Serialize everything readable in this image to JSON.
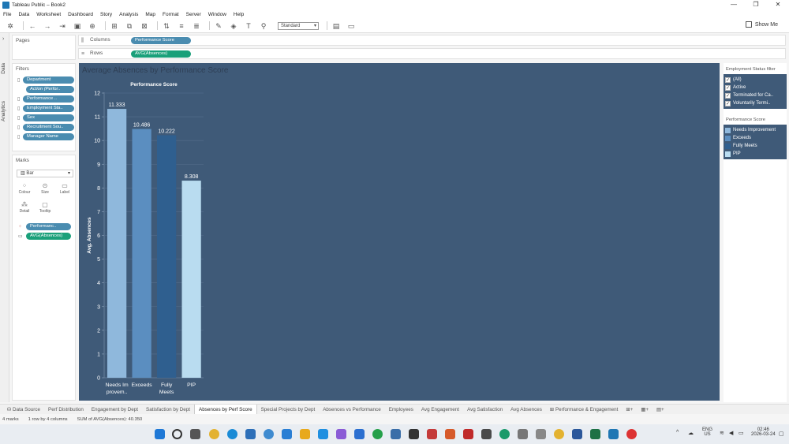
{
  "window": {
    "title": "Tableau Public – Book2",
    "controls": [
      "—",
      "❐",
      "✕"
    ]
  },
  "menu": [
    "File",
    "Data",
    "Worksheet",
    "Dashboard",
    "Story",
    "Analysis",
    "Map",
    "Format",
    "Server",
    "Window",
    "Help"
  ],
  "toolbar": {
    "fit_select": "Standard",
    "show_me": "Show Me"
  },
  "side_tabs": {
    "data": "Data",
    "analytics": "Analytics"
  },
  "pages": {
    "title": "Pages"
  },
  "filters": {
    "title": "Filters",
    "items": [
      {
        "label": "Department",
        "style": "blue"
      },
      {
        "label": "Action (Perfor..",
        "style": "blue-italic"
      },
      {
        "label": "Performance ..",
        "style": "blue"
      },
      {
        "label": "Employment Sta..",
        "style": "blue"
      },
      {
        "label": "Sex",
        "style": "blue"
      },
      {
        "label": "Recruitment Sou..",
        "style": "blue"
      },
      {
        "label": "Manager Name",
        "style": "blue"
      }
    ]
  },
  "marks": {
    "title": "Marks",
    "type": "Bar",
    "buttons": [
      "Colour",
      "Size",
      "Label",
      "Detail",
      "Tooltip"
    ],
    "pills": [
      {
        "label": "Performanc..",
        "style": "blue"
      },
      {
        "label": "AVG(Absences)",
        "style": "green"
      }
    ]
  },
  "shelves": {
    "columns": {
      "label": "Columns",
      "pill": "Performance Score"
    },
    "rows": {
      "label": "Rows",
      "pill": "AVG(Absences)"
    }
  },
  "viz_title": "Average Absences by Performance Score",
  "chart_data": {
    "type": "bar",
    "title": "Performance Score",
    "ylabel": "Avg. Absences",
    "categories": [
      "Needs Im provem..",
      "Exceeds",
      "Fully Meets",
      "PIP"
    ],
    "values": [
      11.333,
      10.486,
      10.222,
      8.308
    ],
    "value_labels": [
      "11.333",
      "10.486",
      "10.222",
      "8.308"
    ],
    "yticks": [
      0,
      1,
      2,
      3,
      4,
      5,
      6,
      7,
      8,
      9,
      10,
      11,
      12
    ],
    "ylim": [
      0,
      12
    ],
    "colors": [
      "#8fb8dc",
      "#5b8ec0",
      "#2f5f8f",
      "#b9dcf0"
    ],
    "grid": true
  },
  "employment_filter": {
    "title": "Employment Status filter",
    "items": [
      "(All)",
      "Active",
      "Terminated for Ca..",
      "Voluntarily Termi.."
    ]
  },
  "performance_legend": {
    "title": "Performance Score",
    "items": [
      {
        "label": "Needs Improvement",
        "color": "#8fb8dc"
      },
      {
        "label": "Exceeds",
        "color": "#5b8ec0"
      },
      {
        "label": "Fully Meets",
        "color": "#2f5f8f"
      },
      {
        "label": "PIP",
        "color": "#b9dcf0"
      }
    ]
  },
  "sheet_tabs": [
    "Data Source",
    "Perf Distribution",
    "Engagement by Dept",
    "Satisfaction by Dept",
    "Absences by Perf Score",
    "Special Projects by Dept",
    "Absences vs Performance",
    "Employees",
    "Avg Engagement",
    "Avg Satisfaction",
    "Avg Absences",
    "Performance & Engagement"
  ],
  "active_sheet": "Absences by Perf Score",
  "status": {
    "marks": "4 marks",
    "rows": "1 row by 4 columns",
    "sum": "SUM of AVG(Absences): 40.350"
  },
  "tray": {
    "lang": "ENG",
    "region": "US",
    "time": "02:46",
    "date": "2026-03-24"
  }
}
